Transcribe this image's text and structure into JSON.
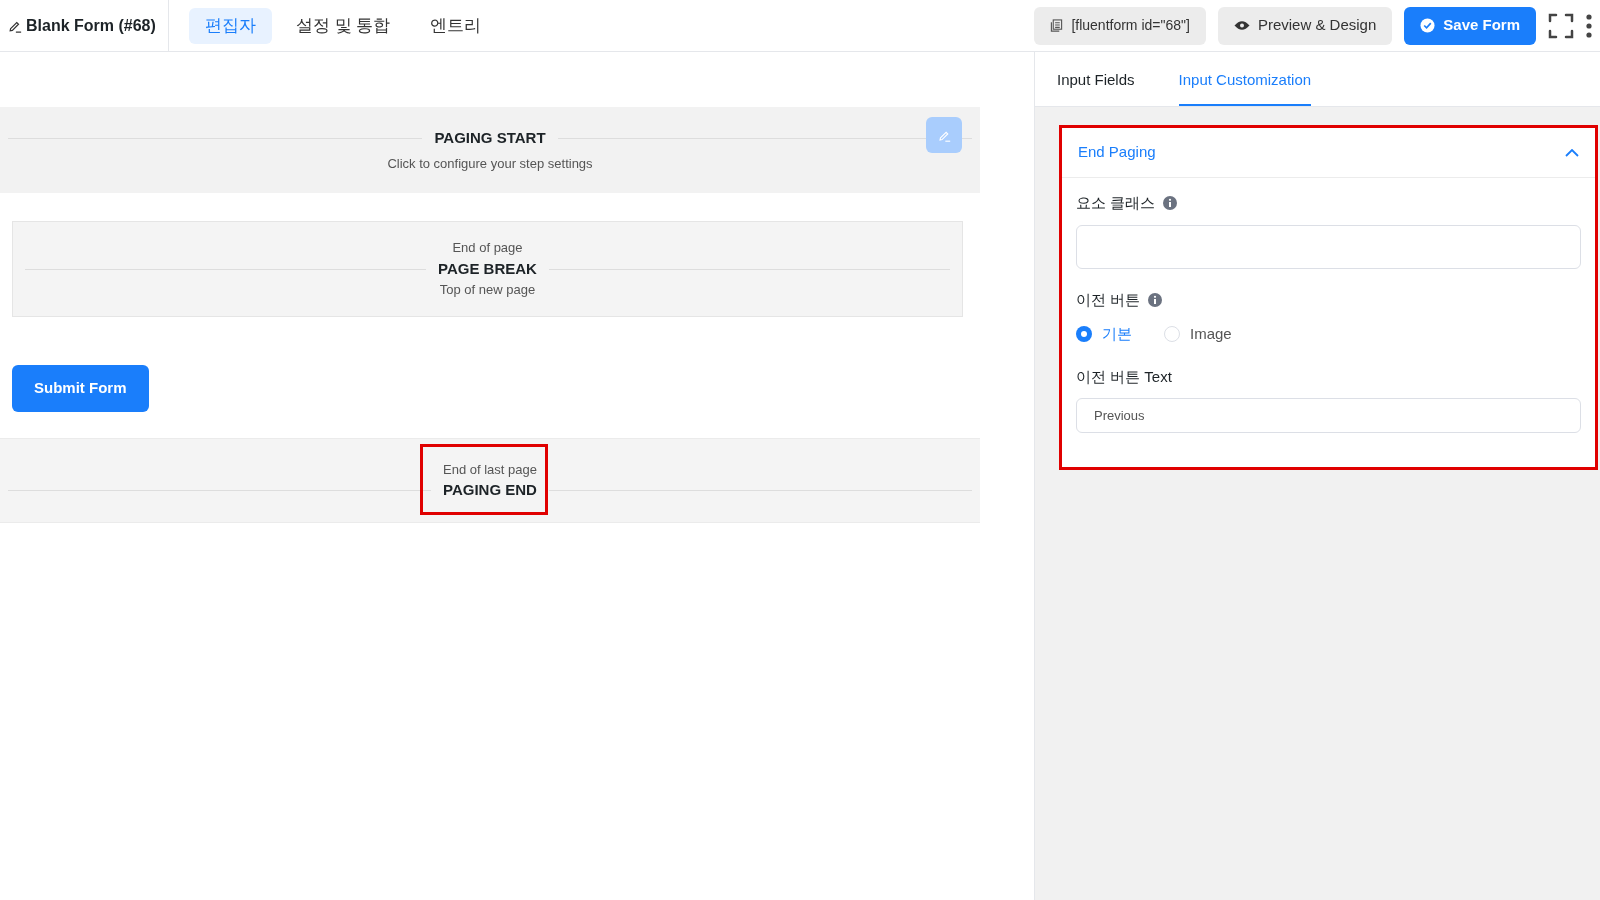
{
  "header": {
    "form_title": "Blank Form (#68)",
    "tabs": [
      {
        "label": "편집자",
        "selected": true
      },
      {
        "label": "설정 및 통합",
        "selected": false
      },
      {
        "label": "엔트리",
        "selected": false
      }
    ],
    "shortcode": "[fluentform id=\"68\"]",
    "preview_button": "Preview & Design",
    "save_button": "Save Form"
  },
  "canvas": {
    "paging_start": {
      "title": "PAGING START",
      "subtitle": "Click to configure your step settings"
    },
    "page_break": {
      "top": "End of page",
      "title": "PAGE BREAK",
      "bottom": "Top of new page"
    },
    "submit_button": "Submit Form",
    "paging_end": {
      "top": "End of last page",
      "title": "PAGING END",
      "highlighted": true
    }
  },
  "sidebar": {
    "tabs": [
      {
        "label": "Input Fields",
        "selected": false
      },
      {
        "label": "Input Customization",
        "selected": true
      }
    ],
    "panel": {
      "title": "End Paging",
      "expanded": true,
      "highlighted": true,
      "fields": [
        {
          "kind": "text",
          "label": "요소 클래스",
          "info": true
        },
        {
          "kind": "radio",
          "label": "이전 버튼",
          "info": true,
          "options": [
            {
              "label": "기본",
              "selected": true
            },
            {
              "label": "Image",
              "selected": false
            }
          ]
        },
        {
          "kind": "text",
          "label": "이전 버튼 Text",
          "info": false,
          "value": "Previous"
        }
      ]
    }
  }
}
